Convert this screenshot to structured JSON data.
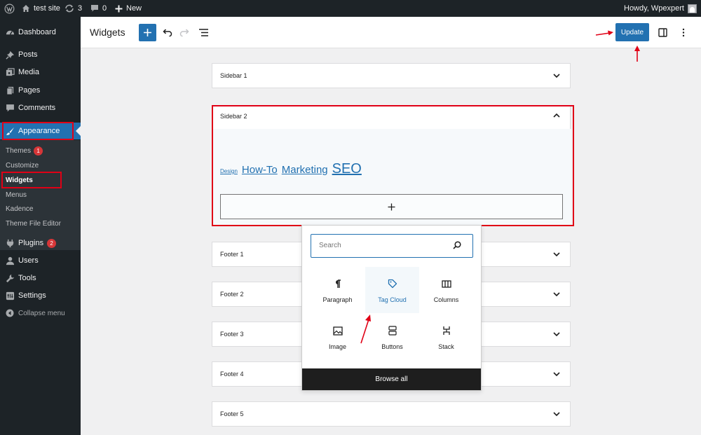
{
  "admin_bar": {
    "site_name": "test site",
    "updates_count": "3",
    "comments_count": "0",
    "new_label": "New",
    "howdy": "Howdy, Wpexpert",
    "icons": [
      "wordpress-logo-icon",
      "home-icon",
      "updates-icon",
      "comment-icon",
      "plus-icon",
      "avatar"
    ]
  },
  "sidebar_menu": {
    "items": [
      {
        "label": "Dashboard",
        "icon": "dashboard-icon"
      },
      {
        "label": "Posts",
        "icon": "pin-icon"
      },
      {
        "label": "Media",
        "icon": "media-icon"
      },
      {
        "label": "Pages",
        "icon": "pages-icon"
      },
      {
        "label": "Comments",
        "icon": "comment-icon"
      },
      {
        "label": "Appearance",
        "icon": "brush-icon"
      },
      {
        "label": "Plugins",
        "icon": "plug-icon",
        "badge": "2"
      },
      {
        "label": "Users",
        "icon": "users-icon"
      },
      {
        "label": "Tools",
        "icon": "wrench-icon"
      },
      {
        "label": "Settings",
        "icon": "settings-icon"
      }
    ],
    "appearance_submenu": [
      {
        "label": "Themes",
        "badge": "1"
      },
      {
        "label": "Customize"
      },
      {
        "label": "Widgets"
      },
      {
        "label": "Menus"
      },
      {
        "label": "Kadence"
      },
      {
        "label": "Theme File Editor"
      }
    ],
    "collapse_label": "Collapse menu"
  },
  "header": {
    "title": "Widgets",
    "update_label": "Update"
  },
  "widget_areas": [
    {
      "title": "Sidebar 1"
    },
    {
      "title": "Sidebar 2"
    },
    {
      "title": "Footer 1"
    },
    {
      "title": "Footer 2"
    },
    {
      "title": "Footer 3"
    },
    {
      "title": "Footer 4"
    },
    {
      "title": "Footer 5"
    }
  ],
  "tag_cloud": [
    "Design",
    "How-To",
    "Marketing",
    "SEO"
  ],
  "inserter": {
    "search_placeholder": "Search",
    "blocks": [
      {
        "label": "Paragraph",
        "icon": "paragraph-icon"
      },
      {
        "label": "Tag Cloud",
        "icon": "tag-icon",
        "highlighted": true
      },
      {
        "label": "Columns",
        "icon": "columns-icon"
      },
      {
        "label": "Image",
        "icon": "image-icon"
      },
      {
        "label": "Buttons",
        "icon": "buttons-icon"
      },
      {
        "label": "Stack",
        "icon": "stack-icon"
      }
    ],
    "browse_all_label": "Browse all"
  },
  "colors": {
    "admin_dark": "#1d2327",
    "accent_blue": "#2271b1",
    "annotation_red": "#e00016"
  }
}
